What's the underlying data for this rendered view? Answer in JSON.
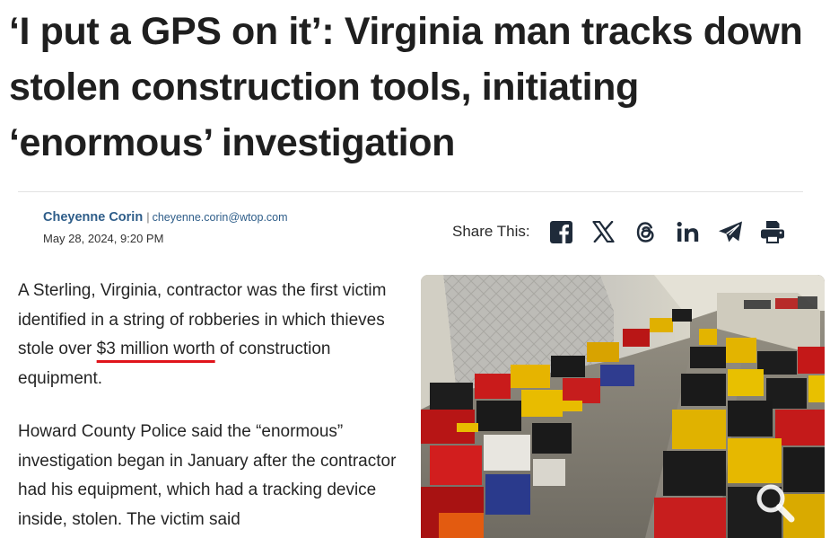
{
  "article": {
    "headline": "‘I put a GPS on it’: Virginia man tracks down stolen construction tools, initiating ‘enormous’ investigation",
    "author": {
      "name": "Cheyenne Corin",
      "separator": "|",
      "email": "cheyenne.corin@wtop.com"
    },
    "date": "May 28, 2024, 9:20 PM",
    "paragraph1": {
      "before": "A Sterling, Virginia, contractor was the first victim identified in a string of robberies in which thieves stole over ",
      "highlight": "$3 million worth",
      "after": " of construction equipment."
    },
    "paragraph2": "Howard County Police said the “enormous” investigation began in January after the contractor had his equipment, which had a tracking device inside, stolen. The victim said"
  },
  "share": {
    "label": "Share This:",
    "icons": [
      "facebook-icon",
      "x-icon",
      "threads-icon",
      "linkedin-icon",
      "telegram-icon",
      "print-icon"
    ],
    "icon_color": "#1f2b3a"
  },
  "image": {
    "subject": "stolen-tools-warehouse",
    "zoom_icon": "magnifier-icon"
  },
  "colors": {
    "author_link": "#2e5d89",
    "highlight_underline": "#e0141b",
    "divider": "#e2e2e2"
  }
}
